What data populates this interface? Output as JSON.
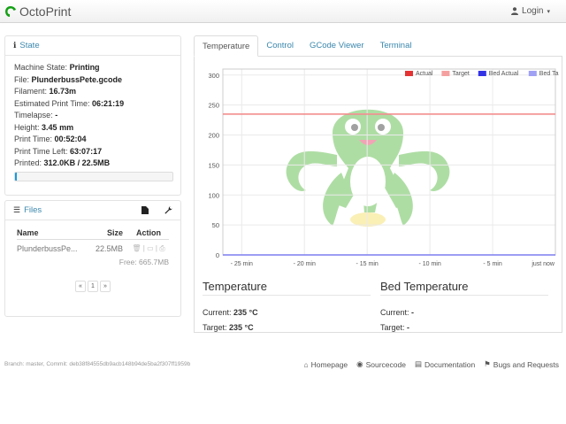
{
  "navbar": {
    "brand": "OctoPrint",
    "login": "Login"
  },
  "state": {
    "title": "State",
    "rows": [
      {
        "label": "Machine State:",
        "value": "Printing"
      },
      {
        "label": "File:",
        "value": "PlunderbussPete.gcode"
      },
      {
        "label": "Filament:",
        "value": "16.73m"
      },
      {
        "label": "Estimated Print Time:",
        "value": "06:21:19"
      },
      {
        "label": "Timelapse:",
        "value": "-"
      },
      {
        "label": "Height:",
        "value": "3.45 mm"
      },
      {
        "label": "Print Time:",
        "value": "00:52:04"
      },
      {
        "label": "Print Time Left:",
        "value": "63:07:17"
      },
      {
        "label": "Printed:",
        "value": "312.0KB / 22.5MB"
      }
    ],
    "progress": 0.014
  },
  "files": {
    "title": "Files",
    "columns": {
      "name": "Name",
      "size": "Size",
      "action": "Action"
    },
    "rows": [
      {
        "name": "PlunderbussPe...",
        "size": "22.5MB"
      }
    ],
    "free": "Free: 665.7MB",
    "pager": {
      "prev": "«",
      "page": "1",
      "next": "»"
    }
  },
  "tabs": [
    "Temperature",
    "Control",
    "GCode Viewer",
    "Terminal"
  ],
  "chart_data": {
    "type": "line",
    "x_ticks": [
      "- 25 min",
      "- 20 min",
      "- 15 min",
      "- 10 min",
      "- 5 min",
      "just now"
    ],
    "x_values": [
      -25,
      -20,
      -15,
      -10,
      -5,
      0
    ],
    "xlim": [
      -26.5,
      0
    ],
    "y_ticks": [
      0,
      50,
      100,
      150,
      200,
      250,
      300
    ],
    "ylim": [
      0,
      310
    ],
    "grid": true,
    "legend_position": "top-right",
    "series": [
      {
        "name": "Actual",
        "color": "#e53333",
        "values": [
          235,
          235,
          235,
          235,
          235,
          235
        ]
      },
      {
        "name": "Target",
        "color": "#f5a0a0",
        "values": [
          235,
          235,
          235,
          235,
          235,
          235
        ]
      },
      {
        "name": "Bed Actual",
        "color": "#3333e5",
        "values": [
          0,
          0,
          0,
          0,
          0,
          0
        ]
      },
      {
        "name": "Bed Target",
        "color": "#a0a0f5",
        "values": [
          0,
          0,
          0,
          0,
          0,
          0
        ]
      }
    ]
  },
  "temperature": {
    "tool": {
      "title": "Temperature",
      "current_label": "Current:",
      "current": "235 °C",
      "target_label": "Target:",
      "target": "235 °C"
    },
    "bed": {
      "title": "Bed Temperature",
      "current_label": "Current:",
      "current": "-",
      "target_label": "Target:",
      "target": "-"
    }
  },
  "footer": {
    "commit": "Branch: master, Commit: deb38f84555db9acb148b94de5ba2f307ff1959b",
    "links": [
      "Homepage",
      "Sourcecode",
      "Documentation",
      "Bugs and Requests"
    ]
  },
  "colors": {
    "link": "#3a87ad",
    "progress": "#149bdf",
    "octopus": "#3fa32f"
  }
}
